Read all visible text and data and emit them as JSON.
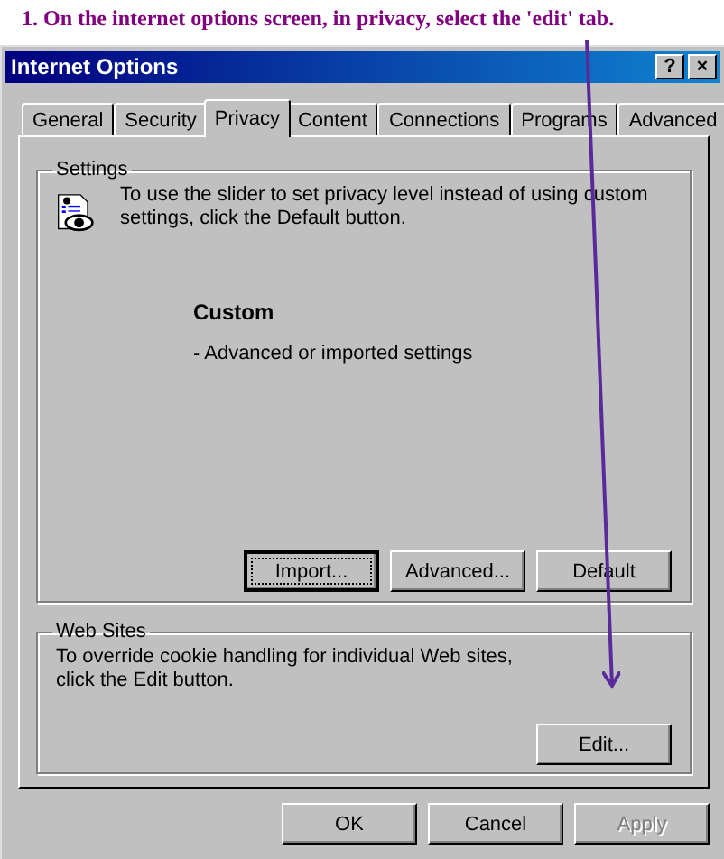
{
  "annotation": {
    "caption": "1. On the internet options screen, in privacy, select the 'edit' tab."
  },
  "window": {
    "title": "Internet Options",
    "title_buttons": [
      "?",
      "×"
    ]
  },
  "tabs": [
    {
      "label": "General",
      "selected": false
    },
    {
      "label": "Security",
      "selected": false
    },
    {
      "label": "Privacy",
      "selected": true
    },
    {
      "label": "Content",
      "selected": false
    },
    {
      "label": "Connections",
      "selected": false
    },
    {
      "label": "Programs",
      "selected": false
    },
    {
      "label": "Advanced",
      "selected": false
    }
  ],
  "settings": {
    "title": "Settings",
    "description": "To use the slider to set privacy level instead of using custom settings, click the Default button.",
    "level_name": "Custom",
    "level_detail": "- Advanced or imported settings",
    "buttons": [
      {
        "label": "Import...",
        "focused": true
      },
      {
        "label": "Advanced...",
        "focused": false
      },
      {
        "label": "Default",
        "focused": false
      }
    ]
  },
  "web_sites": {
    "title": "Web Sites",
    "description": "To override cookie handling for individual Web sites, click the Edit button.",
    "button": "Edit..."
  },
  "buttons": [
    {
      "label": "OK",
      "disabled": false
    },
    {
      "label": "Cancel",
      "disabled": false
    },
    {
      "label": "Apply",
      "disabled": true
    }
  ]
}
